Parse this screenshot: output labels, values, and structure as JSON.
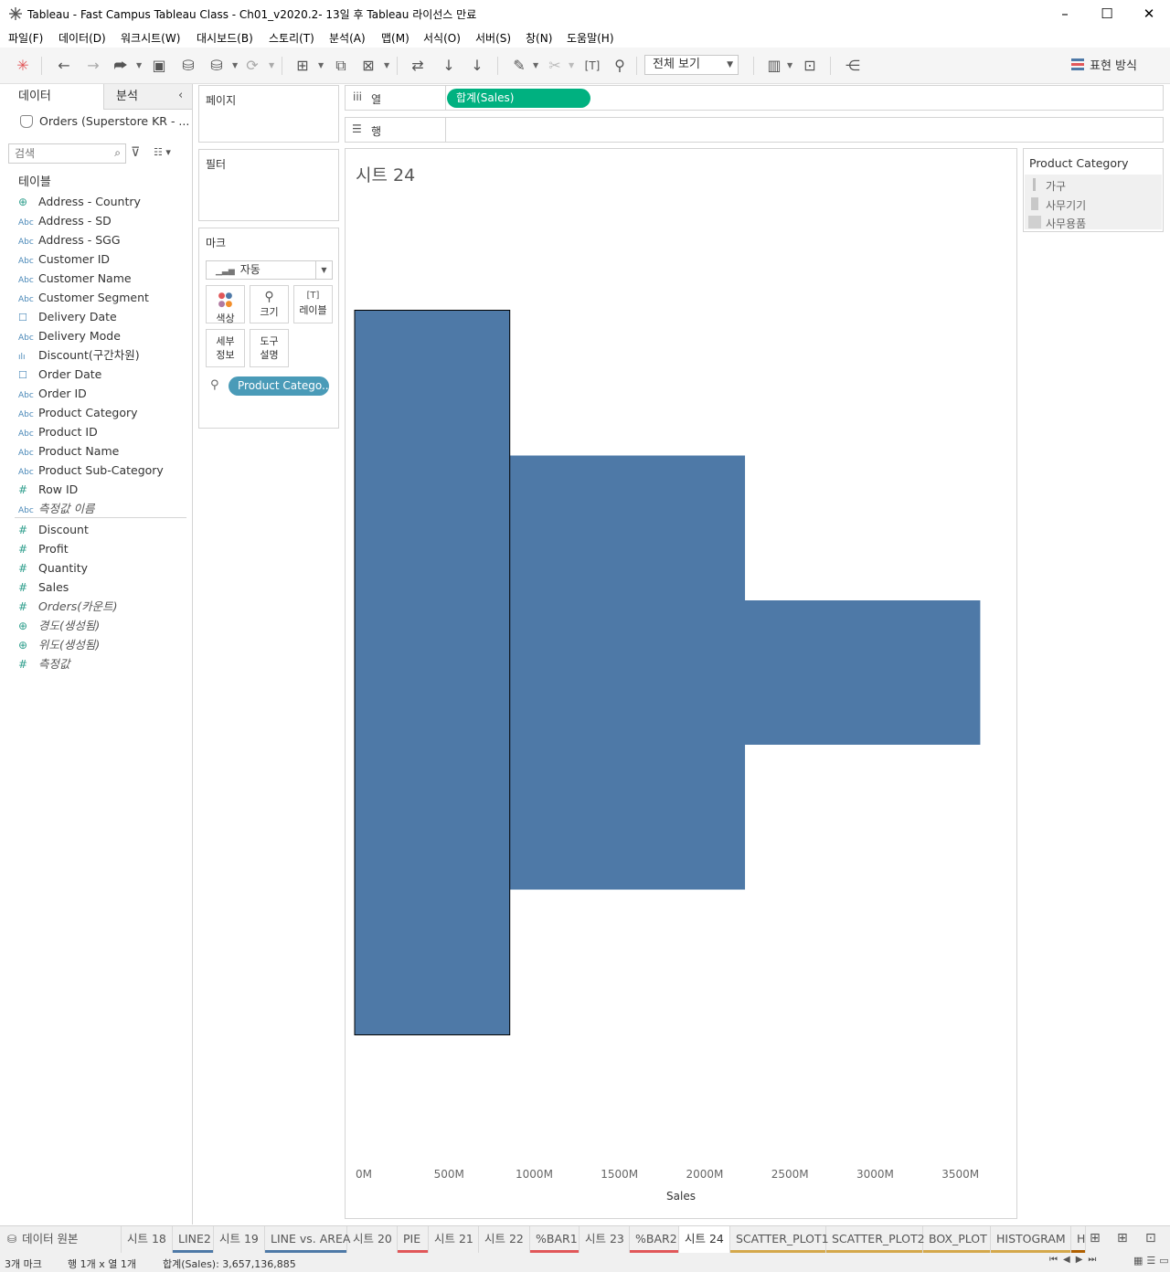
{
  "window": {
    "title": "Tableau - Fast Campus Tableau Class - Ch01_v2020.2- 13일 후 Tableau 라이선스 만료"
  },
  "menu": [
    "파일(F)",
    "데이터(D)",
    "워크시트(W)",
    "대시보드(B)",
    "스토리(T)",
    "분석(A)",
    "맵(M)",
    "서식(O)",
    "서버(S)",
    "창(N)",
    "도움말(H)"
  ],
  "toolbar": {
    "view_select": "전체 보기",
    "show_me": "표현 방식"
  },
  "left_panel": {
    "tab_data": "데이터",
    "tab_analytics": "분석",
    "datasource": "Orders (Superstore KR - ...",
    "search_placeholder": "검색",
    "tables_label": "테이블",
    "dimensions": [
      {
        "icon": "globe",
        "name": "Address - Country"
      },
      {
        "icon": "abc",
        "name": "Address - SD"
      },
      {
        "icon": "abc",
        "name": "Address - SGG"
      },
      {
        "icon": "abc",
        "name": "Customer ID"
      },
      {
        "icon": "abc",
        "name": "Customer Name"
      },
      {
        "icon": "abc",
        "name": "Customer Segment"
      },
      {
        "icon": "date",
        "name": "Delivery Date"
      },
      {
        "icon": "abc",
        "name": "Delivery Mode"
      },
      {
        "icon": "bin",
        "name": "Discount(구간차원)"
      },
      {
        "icon": "date",
        "name": "Order Date"
      },
      {
        "icon": "abc",
        "name": "Order ID"
      },
      {
        "icon": "abc",
        "name": "Product Category"
      },
      {
        "icon": "abc",
        "name": "Product ID"
      },
      {
        "icon": "abc",
        "name": "Product Name"
      },
      {
        "icon": "abc",
        "name": "Product Sub-Category"
      },
      {
        "icon": "hash",
        "name": "Row ID"
      },
      {
        "icon": "abc",
        "name": "측정값 이름"
      }
    ],
    "measures": [
      {
        "icon": "hash",
        "name": "Discount"
      },
      {
        "icon": "hash",
        "name": "Profit"
      },
      {
        "icon": "hash",
        "name": "Quantity"
      },
      {
        "icon": "hash",
        "name": "Sales"
      },
      {
        "icon": "hash",
        "name": "Orders(카운트)"
      },
      {
        "icon": "globe",
        "name": "경도(생성됨)"
      },
      {
        "icon": "globe",
        "name": "위도(생성됨)"
      },
      {
        "icon": "hash",
        "name": "측정값"
      }
    ]
  },
  "shelves": {
    "pages": "페이지",
    "filters": "필터",
    "marks": "마크",
    "mark_type": "자동",
    "mark_buttons": {
      "color": "색상",
      "size": "크기",
      "label": "레이블",
      "detail_1": "세부",
      "detail_2": "정보",
      "tooltip_1": "도구",
      "tooltip_2": "설명"
    },
    "marks_pill": "Product Catego..",
    "columns_label": "열",
    "rows_label": "행",
    "columns_pill": "합계(Sales)"
  },
  "sheet": {
    "title": "시트 24"
  },
  "chart_data": {
    "type": "bar",
    "categories": [
      "가구",
      "사무기기",
      "사무용품"
    ],
    "values": [
      910,
      2290,
      3670
    ],
    "value_unit": "M",
    "xlabel": "Sales",
    "xticks": [
      "0M",
      "500M",
      "1000M",
      "1500M",
      "2000M",
      "2500M",
      "3000M",
      "3500M"
    ],
    "xlim": [
      0,
      3700
    ],
    "color": "#4e79a7"
  },
  "legend": {
    "title": "Product Category",
    "items": [
      "가구",
      "사무기기",
      "사무용품"
    ]
  },
  "sheet_tabs": {
    "datasource": "데이터 원본",
    "tabs": [
      {
        "label": "시트 18",
        "color": ""
      },
      {
        "label": "LINE2",
        "color": "#4e79a7"
      },
      {
        "label": "시트 19",
        "color": ""
      },
      {
        "label": "LINE vs. AREA",
        "color": "#4e79a7"
      },
      {
        "label": "시트 20",
        "color": ""
      },
      {
        "label": "PIE",
        "color": "#e15759"
      },
      {
        "label": "시트 21",
        "color": ""
      },
      {
        "label": "시트 22",
        "color": ""
      },
      {
        "label": "%BAR1",
        "color": "#e15759"
      },
      {
        "label": "시트 23",
        "color": ""
      },
      {
        "label": "%BAR2",
        "color": "#e15759"
      },
      {
        "label": "시트 24",
        "color": ""
      },
      {
        "label": "SCATTER_PLOT1",
        "color": "#d4a84b"
      },
      {
        "label": "SCATTER_PLOT2",
        "color": "#d4a84b"
      },
      {
        "label": "BOX_PLOT",
        "color": "#d4a84b"
      },
      {
        "label": "HISTOGRAM",
        "color": "#d4a84b"
      },
      {
        "label": "H",
        "color": "#b06000"
      }
    ]
  },
  "status": {
    "marks": "3개 마크",
    "rows_cols": "행 1개 x 열 1개",
    "sum": "합계(Sales): 3,657,136,885"
  }
}
